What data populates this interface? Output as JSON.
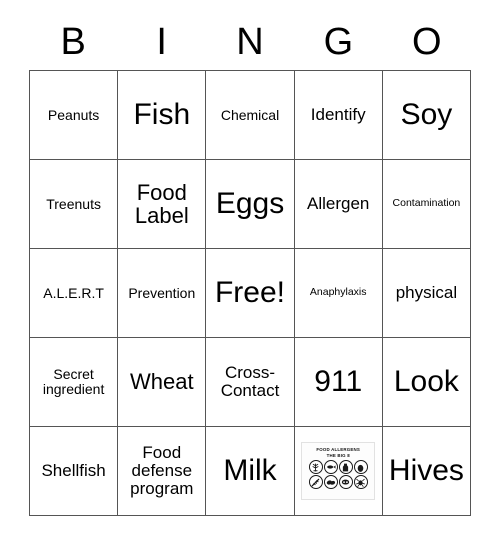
{
  "header": {
    "letters": [
      "B",
      "I",
      "N",
      "G",
      "O"
    ]
  },
  "grid": {
    "rows": [
      [
        {
          "label": "Peanuts",
          "size": "fs-small"
        },
        {
          "label": "Fish",
          "size": "fs-xlarge"
        },
        {
          "label": "Chemical",
          "size": "fs-small"
        },
        {
          "label": "Identify",
          "size": "fs-medium"
        },
        {
          "label": "Soy",
          "size": "fs-xlarge"
        }
      ],
      [
        {
          "label": "Treenuts",
          "size": "fs-small"
        },
        {
          "label": "Food Label",
          "size": "fs-large"
        },
        {
          "label": "Eggs",
          "size": "fs-xlarge"
        },
        {
          "label": "Allergen",
          "size": "fs-medium"
        },
        {
          "label": "Contamination",
          "size": "fs-xsmall"
        }
      ],
      [
        {
          "label": "A.L.E.R.T",
          "size": "fs-small"
        },
        {
          "label": "Prevention",
          "size": "fs-small"
        },
        {
          "label": "Free!",
          "size": "fs-xlarge"
        },
        {
          "label": "Anaphylaxis",
          "size": "fs-xsmall"
        },
        {
          "label": "physical",
          "size": "fs-medium"
        }
      ],
      [
        {
          "label": "Secret ingredient",
          "size": "fs-small"
        },
        {
          "label": "Wheat",
          "size": "fs-large"
        },
        {
          "label": "Cross-Contact",
          "size": "fs-medium"
        },
        {
          "label": "911",
          "size": "fs-xlarge"
        },
        {
          "label": "Look",
          "size": "fs-xlarge"
        }
      ],
      [
        {
          "label": "Shellfish",
          "size": "fs-medium"
        },
        {
          "label": "Food defense program",
          "size": "fs-medium"
        },
        {
          "label": "Milk",
          "size": "fs-xlarge"
        },
        {
          "label": "",
          "size": "fs-small",
          "image": "allergen-chart"
        },
        {
          "label": "Hives",
          "size": "fs-xlarge"
        }
      ]
    ]
  },
  "allergen_image": {
    "title_line1": "FOOD ALLERGENS",
    "title_line2": "THE BIG 8",
    "icons": [
      "peanut-icon",
      "fish-icon",
      "milk-icon",
      "egg-icon",
      "wheat-icon",
      "tree-nut-icon",
      "soy-icon",
      "shellfish-icon"
    ]
  },
  "colors": {
    "border": "#555555",
    "text": "#000000",
    "background": "#ffffff"
  }
}
